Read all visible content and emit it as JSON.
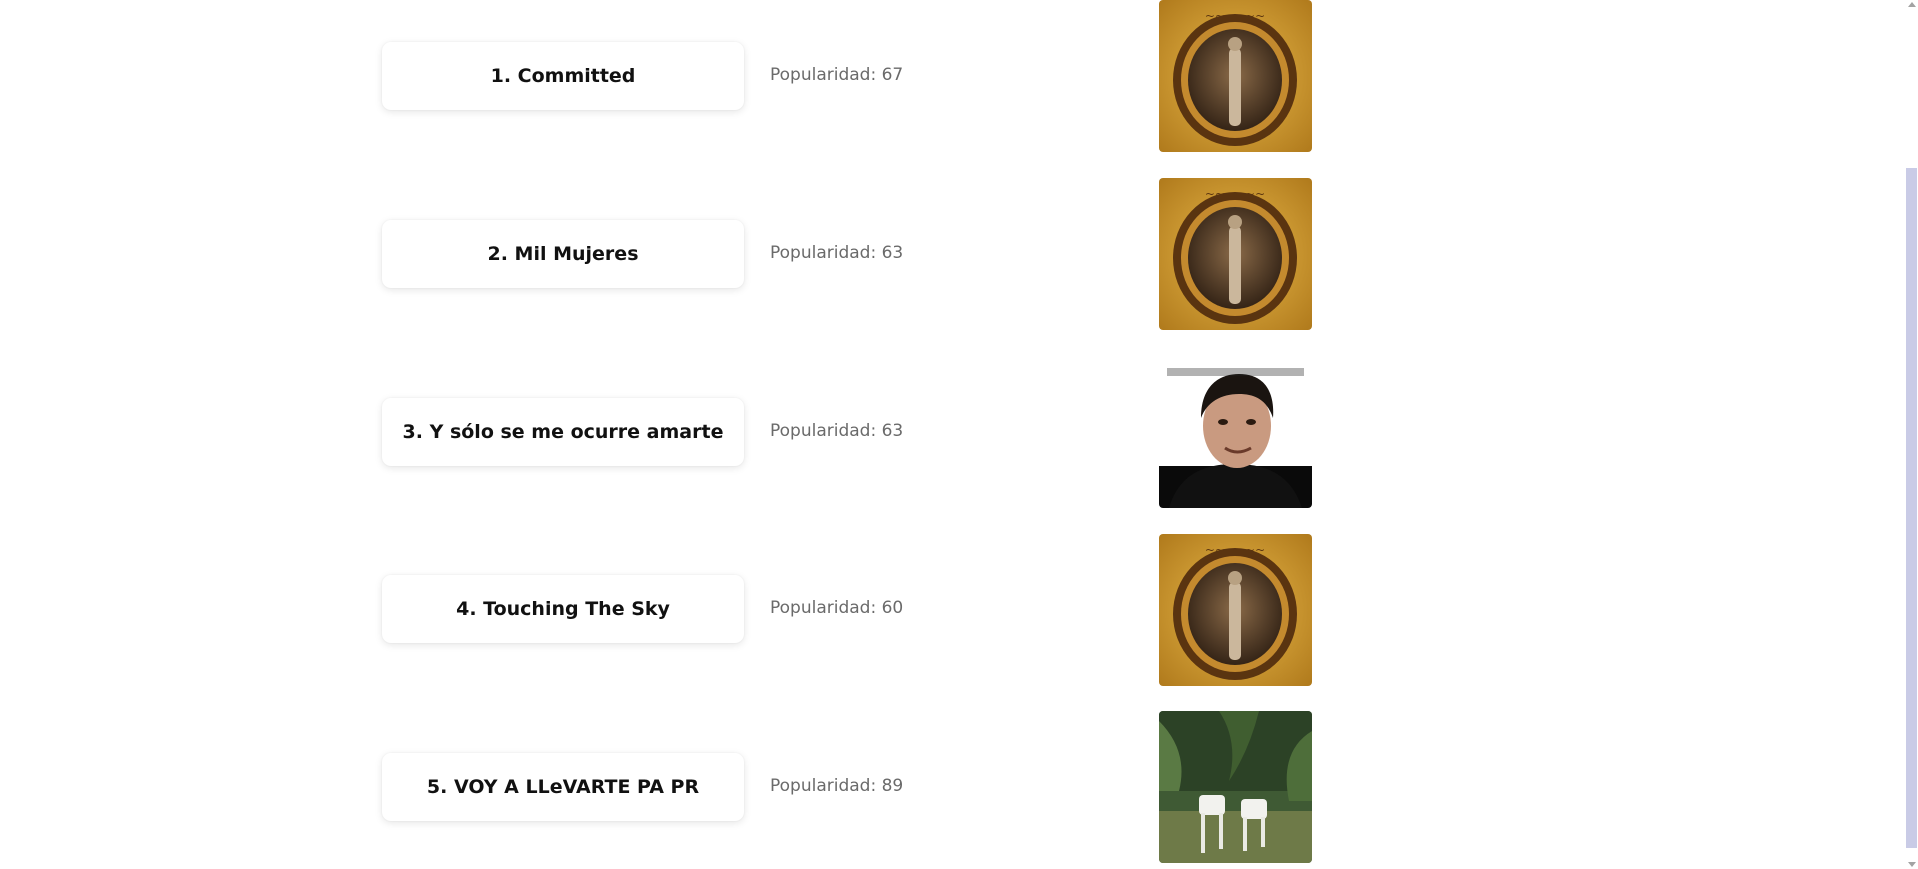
{
  "tracks": [
    {
      "title": "1. Committed",
      "popularity": "Popularidad: 67",
      "cover": "gold-frame-album-cover"
    },
    {
      "title": "2. Mil Mujeres",
      "popularity": "Popularidad: 63",
      "cover": "gold-frame-album-cover"
    },
    {
      "title": "3. Y sólo se me ocurre amarte",
      "popularity": "Popularidad: 63",
      "cover": "portrait-album-cover"
    },
    {
      "title": "4. Touching The Sky",
      "popularity": "Popularidad: 60",
      "cover": "gold-frame-album-cover"
    },
    {
      "title": "5. VOY A LLeVARTE PA PR",
      "popularity": "Popularidad: 89",
      "cover": "plastic-chairs-album-cover"
    }
  ],
  "colors": {
    "card_bg": "#ffffff",
    "title_text": "#111111",
    "popularity_text": "#6a6a6a",
    "scrollbar_thumb": "#c9cbe6"
  }
}
